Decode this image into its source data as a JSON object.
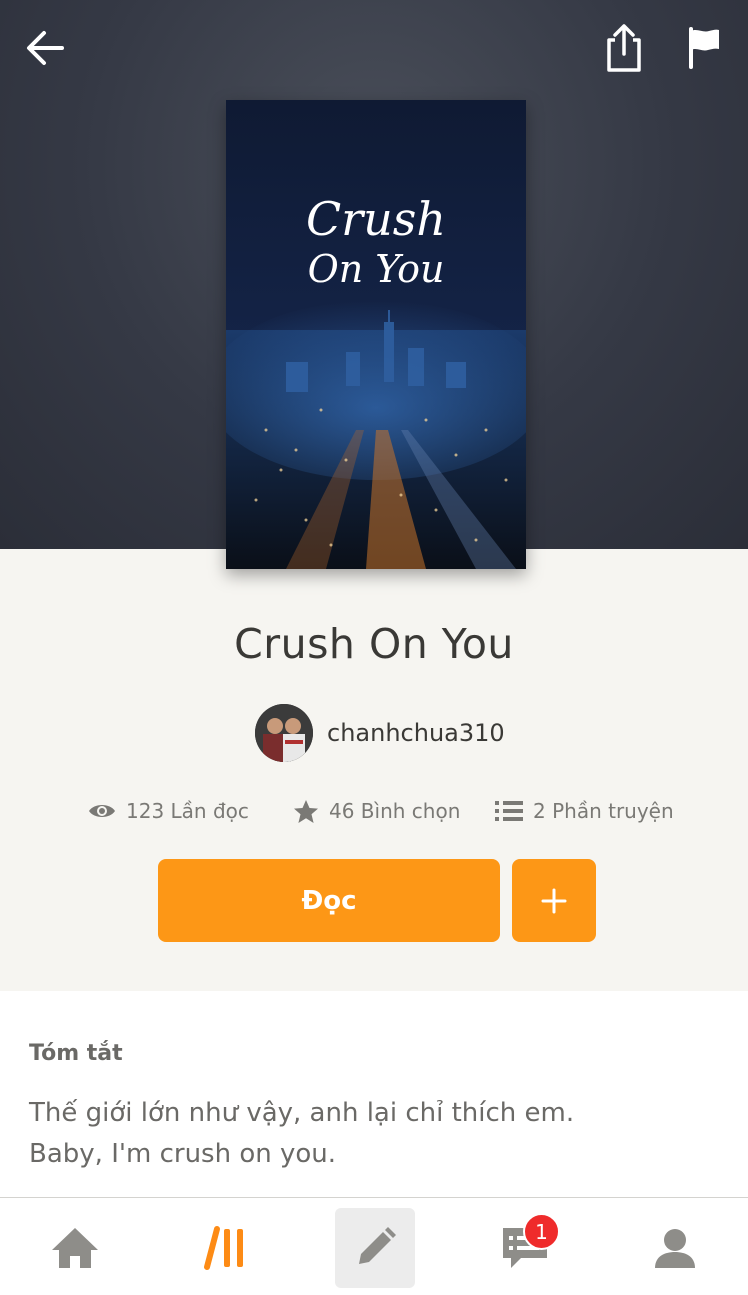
{
  "book": {
    "title": "Crush On You",
    "cover_script_line1": "Crush",
    "cover_script_line2": "On You",
    "author": "chanhchua310"
  },
  "stats": {
    "reads": "123 Lần đọc",
    "votes": "46 Bình chọn",
    "parts": "2 Phần truyện"
  },
  "actions": {
    "read_label": "Đọc",
    "add_label": "+"
  },
  "summary": {
    "heading": "Tóm tắt",
    "text": "Thế giới lớn như vậy, anh lại chỉ thích em.\nBaby, I'm crush on you."
  },
  "nav": {
    "items": [
      "home-icon",
      "library-icon",
      "write-icon",
      "messages-icon",
      "profile-icon"
    ],
    "messages_badge": "1"
  },
  "colors": {
    "accent": "#fd9716",
    "badge": "#ef2b2b",
    "header_bg": "#353945",
    "page_bg": "#f6f5f1"
  }
}
